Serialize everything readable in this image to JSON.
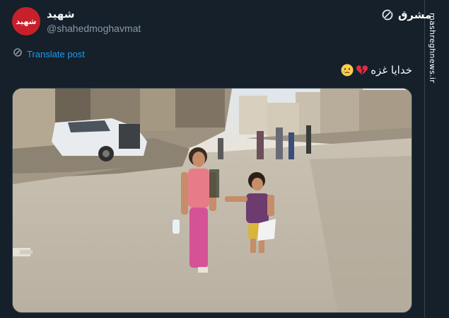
{
  "author": {
    "display_name": "شهید",
    "handle": "@shahedmoghavmat",
    "avatar_text": "شهید",
    "avatar_color": "#c8202a"
  },
  "translate": {
    "icon": "grok-icon",
    "label": "Translate post"
  },
  "post": {
    "text": "خدایا غزه",
    "emojis": [
      "broken-heart-emoji",
      "crying-face-emoji"
    ]
  },
  "media": {
    "type": "video-thumbnail"
  },
  "watermark": {
    "logo": "مشرق",
    "site": "mashreghnews.ir"
  },
  "colors": {
    "background": "#15202b",
    "link": "#1d9bf0",
    "secondary_text": "#8b98a5",
    "border": "#38444d"
  }
}
